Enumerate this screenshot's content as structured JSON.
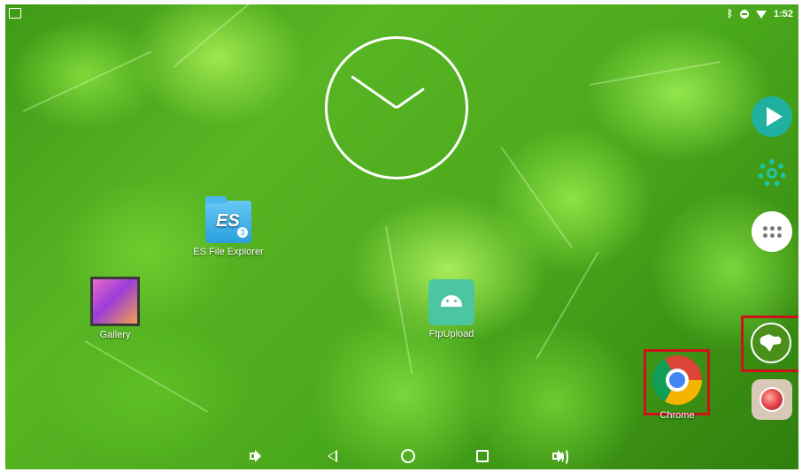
{
  "status_bar": {
    "time": "1:52",
    "icons": [
      "image-icon",
      "bluetooth-icon",
      "do-not-disturb-icon",
      "wifi-icon"
    ]
  },
  "clock_widget": {
    "type": "analog-clock"
  },
  "desktop_apps": [
    {
      "id": "es-file-explorer",
      "label": "ES File Explorer",
      "icon": "es-file-explorer-icon",
      "badge": "3"
    },
    {
      "id": "gallery",
      "label": "Gallery",
      "icon": "gallery-icon"
    },
    {
      "id": "ftpupload",
      "label": "FtpUpload",
      "icon": "android-icon"
    },
    {
      "id": "chrome",
      "label": "Chrome",
      "icon": "chrome-icon",
      "highlighted": true
    }
  ],
  "right_dock": [
    {
      "id": "play-store",
      "icon": "play-icon"
    },
    {
      "id": "settings",
      "icon": "gear-icon"
    },
    {
      "id": "app-drawer",
      "icon": "app-drawer-icon"
    },
    {
      "id": "browser",
      "icon": "globe-icon",
      "highlighted": true
    },
    {
      "id": "camera",
      "icon": "camera-icon"
    }
  ],
  "nav_bar": [
    "volume-down-icon",
    "back-icon",
    "home-icon",
    "recents-icon",
    "volume-up-icon"
  ],
  "colors": {
    "highlight": "#d0101a",
    "accent_teal": "#1ec3a2"
  }
}
